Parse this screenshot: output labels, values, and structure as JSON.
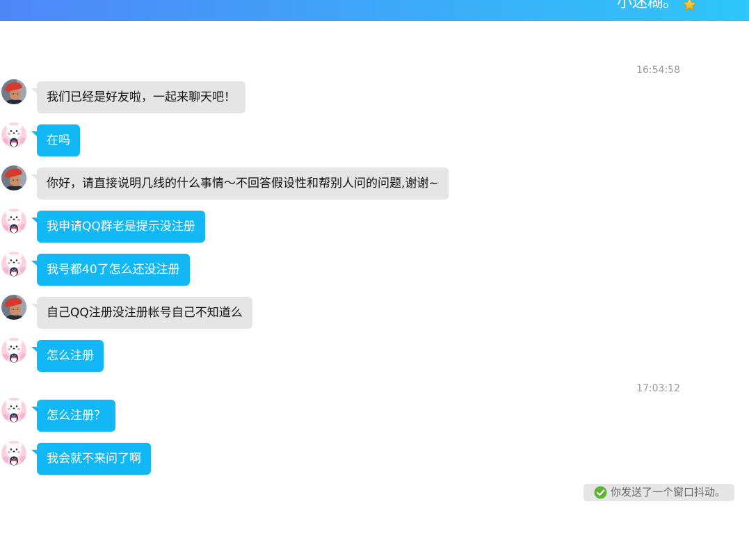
{
  "header": {
    "title": "小迷糊。",
    "badge_icon": "gold-star-icon"
  },
  "timestamps": [
    "16:54:58",
    "17:03:12"
  ],
  "messages": [
    {
      "avatar_icon": "contact-photo-avatar-icon",
      "text": "我们已经是好友啦，一起来聊天吧！"
    },
    {
      "avatar_icon": "penguin-avatar-icon",
      "text": "在吗"
    },
    {
      "avatar_icon": "contact-photo-avatar-icon",
      "text": "你好，请直接说明几线的什么事情～不回答假设性和帮别人问的问题,谢谢~"
    },
    {
      "avatar_icon": "penguin-avatar-icon",
      "text": "我申请QQ群老是提示没注册"
    },
    {
      "avatar_icon": "penguin-avatar-icon",
      "text": "我号都40了怎么还没注册"
    },
    {
      "avatar_icon": "contact-photo-avatar-icon",
      "text": "自己QQ注册没注册帐号自己不知道么"
    },
    {
      "avatar_icon": "penguin-avatar-icon",
      "text": "怎么注册"
    },
    {
      "avatar_icon": "penguin-avatar-icon",
      "text": "怎么注册？"
    },
    {
      "avatar_icon": "penguin-avatar-icon",
      "text": "我会就不来问了啊"
    }
  ],
  "notice": {
    "icon": "check-circle-icon",
    "text": "你发送了一个窗口抖动。"
  },
  "colors": {
    "header_gradient_start": "#4f86f7",
    "header_gradient_end": "#2ec7f8",
    "incoming_bubble": "#e5e5e5",
    "outgoing_bubble": "#12b7f5",
    "notice_check": "#5cb531"
  }
}
